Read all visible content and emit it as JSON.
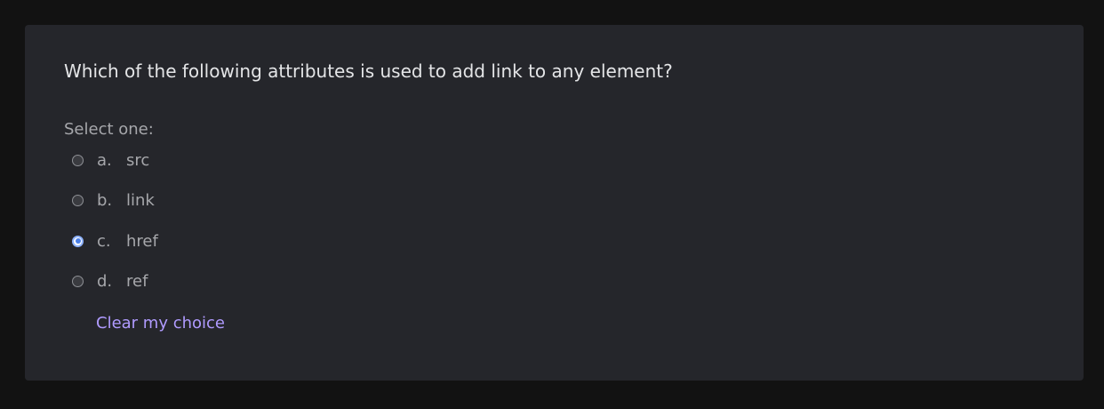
{
  "question": {
    "text": "Which of the following attributes is used to add link to any element?",
    "prompt": "Select one:",
    "options": [
      {
        "letter": "a.",
        "text": "src",
        "selected": false
      },
      {
        "letter": "b.",
        "text": "link",
        "selected": false
      },
      {
        "letter": "c.",
        "text": "href",
        "selected": true
      },
      {
        "letter": "d.",
        "text": "ref",
        "selected": false
      }
    ],
    "clear_label": "Clear my choice"
  },
  "colors": {
    "background": "#121212",
    "card": "#25262b",
    "text": "#e4e5e7",
    "muted_text": "#a6a7ab",
    "link": "#b09bff",
    "radio_selected": "#4a7fe8"
  }
}
